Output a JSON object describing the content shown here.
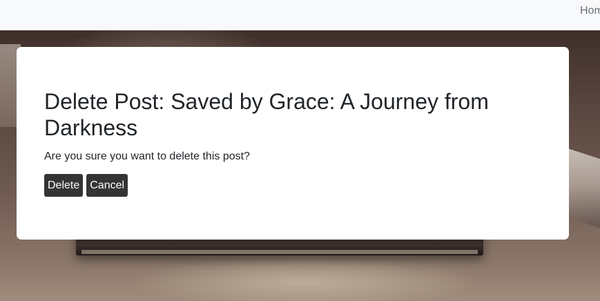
{
  "navbar": {
    "home_label": "Home"
  },
  "dialog": {
    "title": "Delete Post: Saved by Grace: A Journey from Darkness",
    "message": "Are you sure you want to delete this post?",
    "delete_label": "Delete",
    "cancel_label": "Cancel"
  },
  "colors": {
    "navbar_bg": "#f8f9fa",
    "button_bg": "#343434",
    "button_text": "#ffffff",
    "card_bg": "#ffffff",
    "text": "#212529"
  }
}
